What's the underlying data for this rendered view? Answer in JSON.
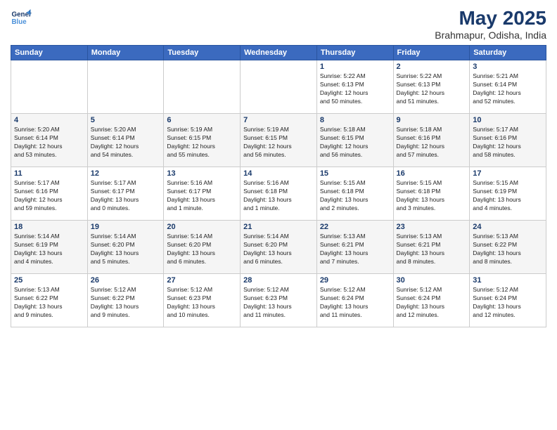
{
  "logo": {
    "line1": "General",
    "line2": "Blue"
  },
  "title": "May 2025",
  "subtitle": "Brahmapur, Odisha, India",
  "weekdays": [
    "Sunday",
    "Monday",
    "Tuesday",
    "Wednesday",
    "Thursday",
    "Friday",
    "Saturday"
  ],
  "weeks": [
    [
      {
        "day": "",
        "info": ""
      },
      {
        "day": "",
        "info": ""
      },
      {
        "day": "",
        "info": ""
      },
      {
        "day": "",
        "info": ""
      },
      {
        "day": "1",
        "info": "Sunrise: 5:22 AM\nSunset: 6:13 PM\nDaylight: 12 hours\nand 50 minutes."
      },
      {
        "day": "2",
        "info": "Sunrise: 5:22 AM\nSunset: 6:13 PM\nDaylight: 12 hours\nand 51 minutes."
      },
      {
        "day": "3",
        "info": "Sunrise: 5:21 AM\nSunset: 6:14 PM\nDaylight: 12 hours\nand 52 minutes."
      }
    ],
    [
      {
        "day": "4",
        "info": "Sunrise: 5:20 AM\nSunset: 6:14 PM\nDaylight: 12 hours\nand 53 minutes."
      },
      {
        "day": "5",
        "info": "Sunrise: 5:20 AM\nSunset: 6:14 PM\nDaylight: 12 hours\nand 54 minutes."
      },
      {
        "day": "6",
        "info": "Sunrise: 5:19 AM\nSunset: 6:15 PM\nDaylight: 12 hours\nand 55 minutes."
      },
      {
        "day": "7",
        "info": "Sunrise: 5:19 AM\nSunset: 6:15 PM\nDaylight: 12 hours\nand 56 minutes."
      },
      {
        "day": "8",
        "info": "Sunrise: 5:18 AM\nSunset: 6:15 PM\nDaylight: 12 hours\nand 56 minutes."
      },
      {
        "day": "9",
        "info": "Sunrise: 5:18 AM\nSunset: 6:16 PM\nDaylight: 12 hours\nand 57 minutes."
      },
      {
        "day": "10",
        "info": "Sunrise: 5:17 AM\nSunset: 6:16 PM\nDaylight: 12 hours\nand 58 minutes."
      }
    ],
    [
      {
        "day": "11",
        "info": "Sunrise: 5:17 AM\nSunset: 6:16 PM\nDaylight: 12 hours\nand 59 minutes."
      },
      {
        "day": "12",
        "info": "Sunrise: 5:17 AM\nSunset: 6:17 PM\nDaylight: 13 hours\nand 0 minutes."
      },
      {
        "day": "13",
        "info": "Sunrise: 5:16 AM\nSunset: 6:17 PM\nDaylight: 13 hours\nand 1 minute."
      },
      {
        "day": "14",
        "info": "Sunrise: 5:16 AM\nSunset: 6:18 PM\nDaylight: 13 hours\nand 1 minute."
      },
      {
        "day": "15",
        "info": "Sunrise: 5:15 AM\nSunset: 6:18 PM\nDaylight: 13 hours\nand 2 minutes."
      },
      {
        "day": "16",
        "info": "Sunrise: 5:15 AM\nSunset: 6:18 PM\nDaylight: 13 hours\nand 3 minutes."
      },
      {
        "day": "17",
        "info": "Sunrise: 5:15 AM\nSunset: 6:19 PM\nDaylight: 13 hours\nand 4 minutes."
      }
    ],
    [
      {
        "day": "18",
        "info": "Sunrise: 5:14 AM\nSunset: 6:19 PM\nDaylight: 13 hours\nand 4 minutes."
      },
      {
        "day": "19",
        "info": "Sunrise: 5:14 AM\nSunset: 6:20 PM\nDaylight: 13 hours\nand 5 minutes."
      },
      {
        "day": "20",
        "info": "Sunrise: 5:14 AM\nSunset: 6:20 PM\nDaylight: 13 hours\nand 6 minutes."
      },
      {
        "day": "21",
        "info": "Sunrise: 5:14 AM\nSunset: 6:20 PM\nDaylight: 13 hours\nand 6 minutes."
      },
      {
        "day": "22",
        "info": "Sunrise: 5:13 AM\nSunset: 6:21 PM\nDaylight: 13 hours\nand 7 minutes."
      },
      {
        "day": "23",
        "info": "Sunrise: 5:13 AM\nSunset: 6:21 PM\nDaylight: 13 hours\nand 8 minutes."
      },
      {
        "day": "24",
        "info": "Sunrise: 5:13 AM\nSunset: 6:22 PM\nDaylight: 13 hours\nand 8 minutes."
      }
    ],
    [
      {
        "day": "25",
        "info": "Sunrise: 5:13 AM\nSunset: 6:22 PM\nDaylight: 13 hours\nand 9 minutes."
      },
      {
        "day": "26",
        "info": "Sunrise: 5:12 AM\nSunset: 6:22 PM\nDaylight: 13 hours\nand 9 minutes."
      },
      {
        "day": "27",
        "info": "Sunrise: 5:12 AM\nSunset: 6:23 PM\nDaylight: 13 hours\nand 10 minutes."
      },
      {
        "day": "28",
        "info": "Sunrise: 5:12 AM\nSunset: 6:23 PM\nDaylight: 13 hours\nand 11 minutes."
      },
      {
        "day": "29",
        "info": "Sunrise: 5:12 AM\nSunset: 6:24 PM\nDaylight: 13 hours\nand 11 minutes."
      },
      {
        "day": "30",
        "info": "Sunrise: 5:12 AM\nSunset: 6:24 PM\nDaylight: 13 hours\nand 12 minutes."
      },
      {
        "day": "31",
        "info": "Sunrise: 5:12 AM\nSunset: 6:24 PM\nDaylight: 13 hours\nand 12 minutes."
      }
    ]
  ]
}
